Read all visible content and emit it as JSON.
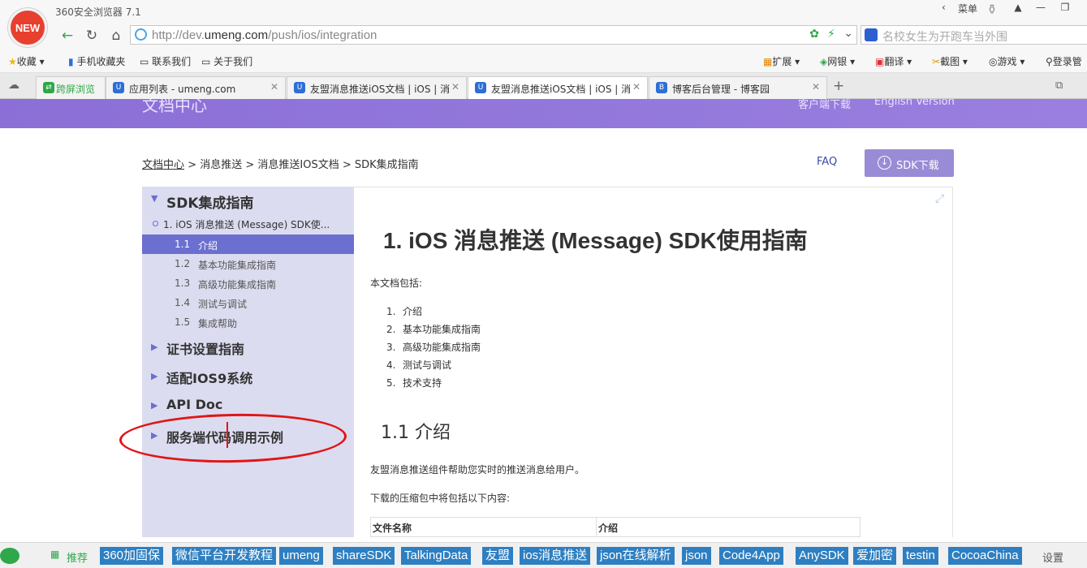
{
  "browser": {
    "logo_text": "NEW",
    "title": "360安全浏览器 7.1",
    "menu_label": "菜单",
    "url_prefix": "http://dev.",
    "url_domain": "umeng.com",
    "url_path": "/push/ios/integration",
    "search_text": "名校女生为开跑车当外围"
  },
  "bookmarks": {
    "left": [
      "收藏",
      "手机收藏夹",
      "联系我们",
      "关于我们"
    ],
    "right": [
      "扩展",
      "网银",
      "翻译",
      "截图",
      "游戏",
      "登录管"
    ]
  },
  "tabs": [
    {
      "label": "跨屏浏览"
    },
    {
      "label": "应用列表 - umeng.com"
    },
    {
      "label": "友盟消息推送iOS文档 | iOS | 消"
    },
    {
      "label": "友盟消息推送iOS文档 | iOS | 消"
    },
    {
      "label": "博客后台管理 - 博客园"
    }
  ],
  "header": {
    "doc_center": "文档中心",
    "client_download": "客户端下载",
    "english": "English Version"
  },
  "breadcrumb": {
    "home": "文档中心",
    "sep": " > ",
    "b1": "消息推送",
    "b2": "消息推送IOS文档",
    "b3": "SDK集成指南"
  },
  "faq": "FAQ",
  "sdk_button": "SDK下载",
  "sidebar": {
    "section1": "SDK集成指南",
    "sub1": "1.  iOS 消息推送 (Message) SDK使...",
    "items": [
      {
        "num": "1.1",
        "label": "介绍"
      },
      {
        "num": "1.2",
        "label": "基本功能集成指南"
      },
      {
        "num": "1.3",
        "label": "高级功能集成指南"
      },
      {
        "num": "1.4",
        "label": "测试与调试"
      },
      {
        "num": "1.5",
        "label": "集成帮助"
      }
    ],
    "section2": "证书设置指南",
    "section3": "适配IOS9系统",
    "section4": "API Doc",
    "section5": "服务端代码调用示例"
  },
  "content": {
    "h1": "1.  iOS 消息推送 (Message) SDK使用指南",
    "intro": "本文档包括:",
    "list": [
      {
        "n": "1.",
        "t": "介绍"
      },
      {
        "n": "2.",
        "t": "基本功能集成指南"
      },
      {
        "n": "3.",
        "t": "高级功能集成指南"
      },
      {
        "n": "4.",
        "t": "测试与调试"
      },
      {
        "n": "5.",
        "t": "技术支持"
      }
    ],
    "h2": "1.1   介绍",
    "p1": "友盟消息推送组件帮助您实时的推送消息给用户。",
    "p2": "下载的压缩包中将包括以下内容:",
    "table_headers": [
      "文件名称",
      "介绍"
    ]
  },
  "bottom": {
    "recommend": "推荐",
    "links": [
      "360加固保",
      "微信平台开发教程",
      "umeng",
      "shareSDK",
      "TalkingData",
      "友盟",
      "ios消息推送",
      "json在线解析",
      "json",
      "Code4App",
      "AnySDK",
      "爱加密",
      "testin",
      "CocoaChina"
    ],
    "settings": "设置"
  }
}
